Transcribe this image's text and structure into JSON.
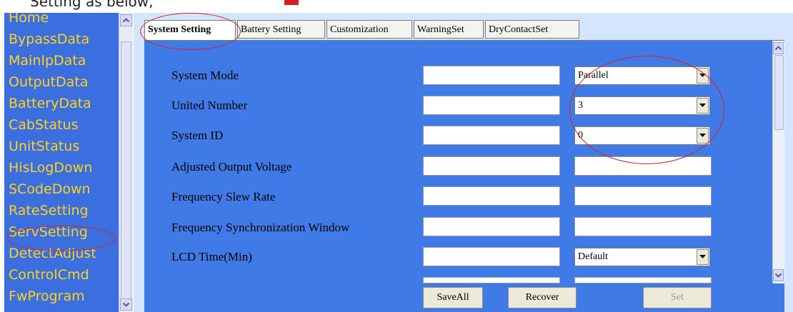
{
  "top_fragment": "Setting  as below,",
  "nav": {
    "items": [
      "Home",
      "BypassData",
      "MainIpData",
      "OutputData",
      "BatteryData",
      "CabStatus",
      "UnitStatus",
      "HisLogDown",
      "SCodeDown",
      "RateSetting",
      "ServSetting",
      "DetectAdjust",
      "ControlCmd",
      "FwProgram"
    ]
  },
  "tabs": [
    "System Setting",
    "Battery Setting",
    "Customization",
    "WarningSet",
    "DryContactSet"
  ],
  "form": {
    "rows": [
      {
        "label": "System Mode",
        "value": "",
        "select": "Parallel"
      },
      {
        "label": "United Number",
        "value": "",
        "select": "3"
      },
      {
        "label": "System ID",
        "value": "",
        "select": "0"
      },
      {
        "label": "Adjusted Output Voltage",
        "value": "",
        "select": null
      },
      {
        "label": "Frequency Slew Rate",
        "value": "",
        "select": null
      },
      {
        "label": "Frequency Synchronization Window",
        "value": "",
        "select": null
      },
      {
        "label": "LCD Time(Min)",
        "value": "",
        "select": "Default"
      }
    ]
  },
  "buttons": {
    "save_all": "SaveAll",
    "recover": "Recover",
    "set": "Set"
  },
  "colors": {
    "nav_bg": "#3b6fe0",
    "nav_text": "#ffd21a",
    "panel_bg": "#3f7ae6",
    "frame_bg": "#d4e6ff",
    "annotation": "#d7261e"
  },
  "icons": [
    "scroll-up-icon",
    "scroll-down-icon",
    "dropdown-arrow-icon"
  ]
}
